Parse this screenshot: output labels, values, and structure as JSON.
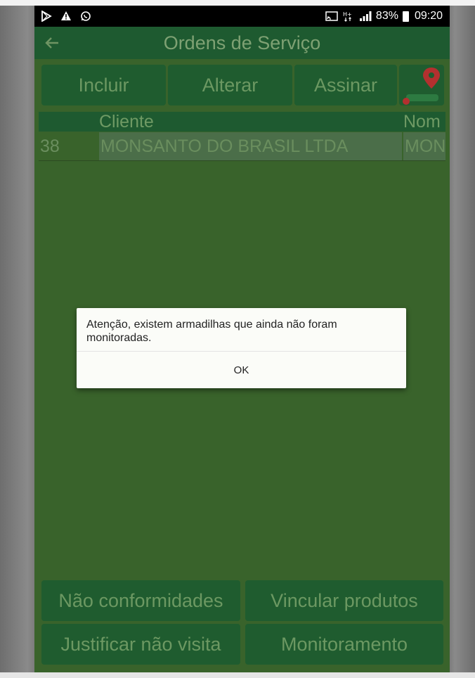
{
  "status_bar": {
    "battery": "83%",
    "time": "09:20"
  },
  "app_bar": {
    "title": "Ordens de Serviço"
  },
  "toolbar": {
    "incluir": "Incluir",
    "alterar": "Alterar",
    "assinar": "Assinar"
  },
  "table": {
    "columns": [
      "Cliente",
      "Nom"
    ],
    "rows": [
      {
        "id": "38",
        "cliente": "MONSANTO DO BRASIL LTDA",
        "nome": "MON"
      }
    ]
  },
  "dialog": {
    "message": "Atenção, existem armadilhas que ainda não foram monitoradas.",
    "ok": "OK"
  },
  "bottom_buttons": {
    "nao_conformidades": "Não conformidades",
    "vincular_produtos": "Vincular produtos",
    "justificar_nao_visita": "Justificar não visita",
    "monitoramento": "Monitoramento"
  },
  "colors": {
    "app_bar": "#1e5a30",
    "background_dimmed": "#39632b",
    "button": "#1f5c2f",
    "dialog": "#fbfcf8",
    "map_pin": "#e53935"
  },
  "icons": [
    "play-store-icon",
    "warning-icon",
    "whatsapp-icon",
    "cast-icon",
    "network-icon",
    "signal-icon",
    "battery-icon",
    "back-arrow-icon",
    "map-pin-icon"
  ]
}
